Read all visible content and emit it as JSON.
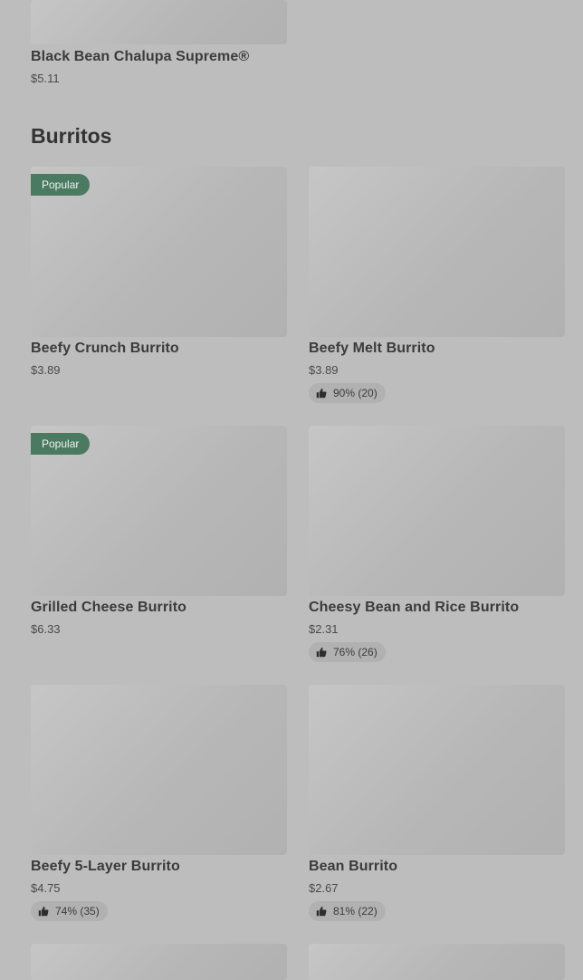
{
  "colors": {
    "badge": "#4a7b60",
    "background": "#bdbdbd"
  },
  "previous_item": {
    "name": "Black Bean Chalupa Supreme®",
    "price": "$5.11"
  },
  "section": {
    "title": "Burritos"
  },
  "badge_label": "Popular",
  "items": [
    {
      "name": "Beefy Crunch Burrito",
      "price": "$3.89",
      "badge": "Popular"
    },
    {
      "name": "Beefy Melt Burrito",
      "price": "$3.89",
      "rating": "90% (20)"
    },
    {
      "name": "Grilled Cheese Burrito",
      "price": "$6.33",
      "badge": "Popular"
    },
    {
      "name": "Cheesy Bean and Rice Burrito",
      "price": "$2.31",
      "rating": "76% (26)"
    },
    {
      "name": "Beefy 5-Layer Burrito",
      "price": "$4.75",
      "rating": "74% (35)"
    },
    {
      "name": "Bean Burrito",
      "price": "$2.67",
      "rating": "81% (22)"
    }
  ],
  "icons": {
    "rating": "thumbs-up-icon"
  }
}
